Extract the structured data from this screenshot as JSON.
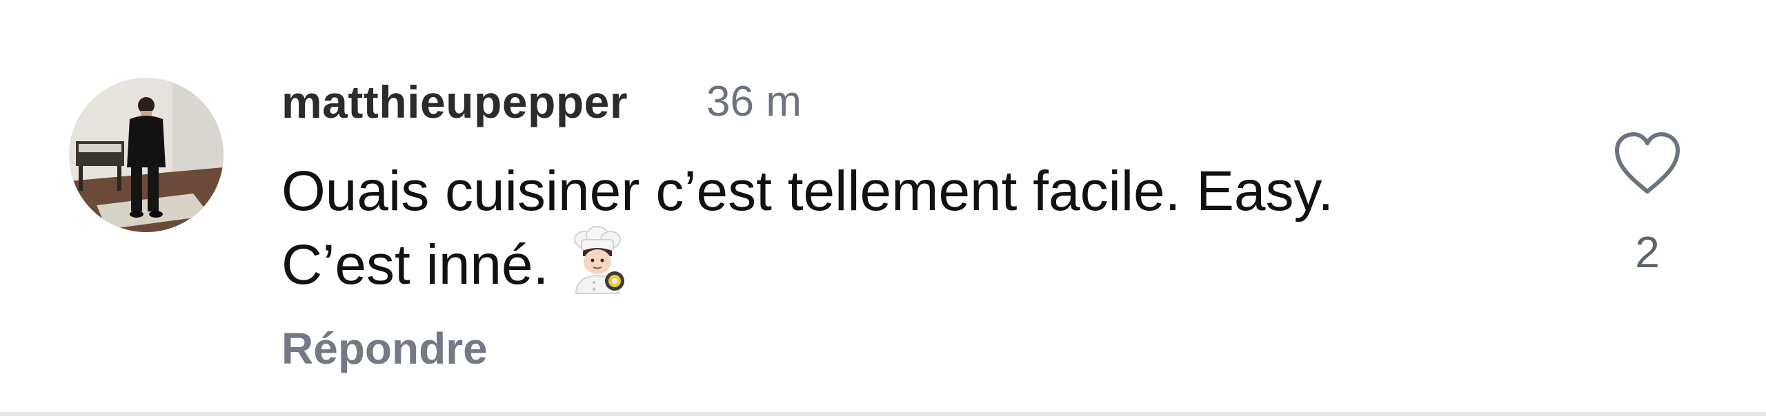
{
  "comment": {
    "author": "matthieupepper",
    "time": "36 m",
    "text_line1": "Ouais cuisiner c’est tellement facile. Easy.",
    "text_line2": "C’est inné.",
    "emoji": "chef-emoji",
    "reply_label": "Répondre",
    "like_count": "2",
    "like_icon": "heart-outline-icon"
  },
  "colors": {
    "username": "#2b2b2b",
    "timestamp": "#6b7280",
    "text": "#111111",
    "reply": "#747985",
    "like_icon": "#6b7280",
    "like_count": "#5b6270",
    "divider": "#e7e7e9"
  }
}
